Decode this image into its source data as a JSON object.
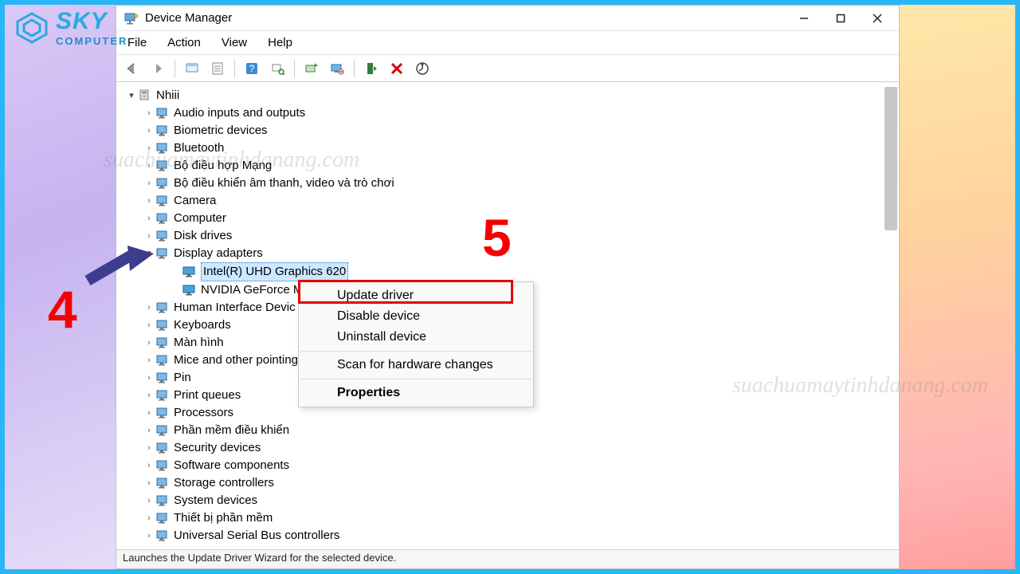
{
  "logo": {
    "line1": "SKY",
    "line2": "COMPUTER"
  },
  "watermark": "suachuamaytinhdanang.com",
  "window": {
    "title": "Device Manager",
    "menus": {
      "file": "File",
      "action": "Action",
      "view": "View",
      "help": "Help"
    },
    "statusbar": "Launches the Update Driver Wizard for the selected device."
  },
  "tree": {
    "root": "Nhiii",
    "items": [
      {
        "label": "Audio inputs and outputs"
      },
      {
        "label": "Biometric devices"
      },
      {
        "label": "Bluetooth"
      },
      {
        "label": "Bộ điều hợp Mạng"
      },
      {
        "label": "Bộ điều khiển âm thanh, video và trò chơi"
      },
      {
        "label": "Camera"
      },
      {
        "label": "Computer"
      },
      {
        "label": "Disk drives"
      },
      {
        "label": "Display adapters",
        "expanded": true,
        "children": [
          {
            "label": "Intel(R) UHD Graphics 620",
            "selected": true
          },
          {
            "label": "NVIDIA GeForce MX"
          }
        ]
      },
      {
        "label": "Human Interface Devic"
      },
      {
        "label": "Keyboards"
      },
      {
        "label": "Màn hình"
      },
      {
        "label": "Mice and other pointing"
      },
      {
        "label": "Pin"
      },
      {
        "label": "Print queues"
      },
      {
        "label": "Processors"
      },
      {
        "label": "Phần mềm điều khiển"
      },
      {
        "label": "Security devices"
      },
      {
        "label": "Software components"
      },
      {
        "label": "Storage controllers"
      },
      {
        "label": "System devices"
      },
      {
        "label": "Thiết bị phần mềm"
      },
      {
        "label": "Universal Serial Bus controllers"
      }
    ]
  },
  "contextMenu": {
    "updateDriver": "Update driver",
    "disableDevice": "Disable device",
    "uninstallDevice": "Uninstall device",
    "scanHardware": "Scan for hardware changes",
    "properties": "Properties"
  },
  "annotations": {
    "step4": "4",
    "step5": "5"
  }
}
